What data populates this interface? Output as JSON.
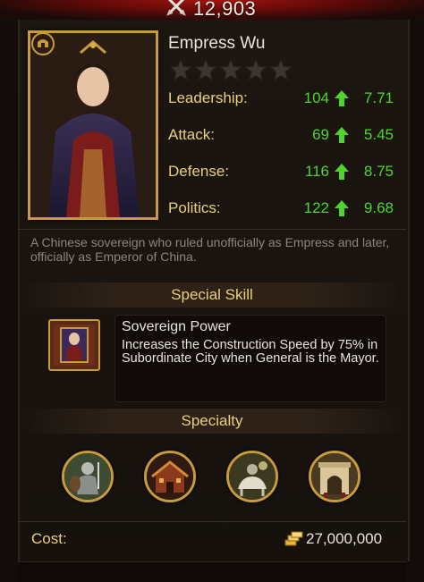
{
  "header": {
    "power": "12,903"
  },
  "general": {
    "name": "Empress Wu",
    "stars_filled": 0,
    "stars_total": 5,
    "stats": [
      {
        "label": "Leadership:",
        "value": "104",
        "growth": "7.71"
      },
      {
        "label": "Attack:",
        "value": "69",
        "growth": "5.45"
      },
      {
        "label": "Defense:",
        "value": "116",
        "growth": "8.75"
      },
      {
        "label": "Politics:",
        "value": "122",
        "growth": "9.68"
      }
    ],
    "bio": "A Chinese sovereign who ruled unofficially as Empress and later, officially as Emperor of China."
  },
  "special_skill": {
    "header": "Special Skill",
    "name": "Sovereign Power",
    "description": "Increases the Construction Speed by 75% in Subordinate City when General is the Mayor."
  },
  "specialty": {
    "header": "Specialty",
    "icons": [
      "infantry-icon",
      "building-icon",
      "cavalry-icon",
      "city-gate-icon"
    ]
  },
  "cost": {
    "label": "Cost:",
    "value": "27,000,000",
    "icon": "gold-icon"
  },
  "colors": {
    "label_gold": "#e8d07a",
    "stat_green": "#4fd42b",
    "frame_gold": "#c79a3d",
    "text_light": "#e9e4da",
    "bio_gray": "#8f8478"
  }
}
